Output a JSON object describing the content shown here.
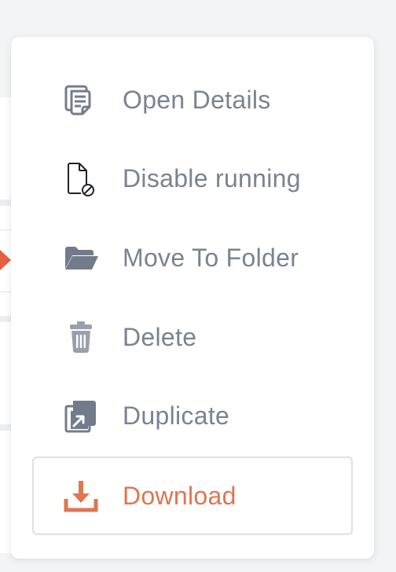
{
  "menu": {
    "items": [
      {
        "label": "Open Details",
        "icon": "documents-icon"
      },
      {
        "label": "Disable running",
        "icon": "file-disabled-icon"
      },
      {
        "label": "Move To Folder",
        "icon": "folder-open-icon"
      },
      {
        "label": "Delete",
        "icon": "trash-icon"
      },
      {
        "label": "Duplicate",
        "icon": "duplicate-icon"
      },
      {
        "label": "Download",
        "icon": "download-icon"
      }
    ]
  },
  "colors": {
    "text": "#7b8291",
    "icon": "#737b8b",
    "accent": "#e0754f",
    "highlight_border": "#dde0e5",
    "background": "#f3f4f6"
  }
}
